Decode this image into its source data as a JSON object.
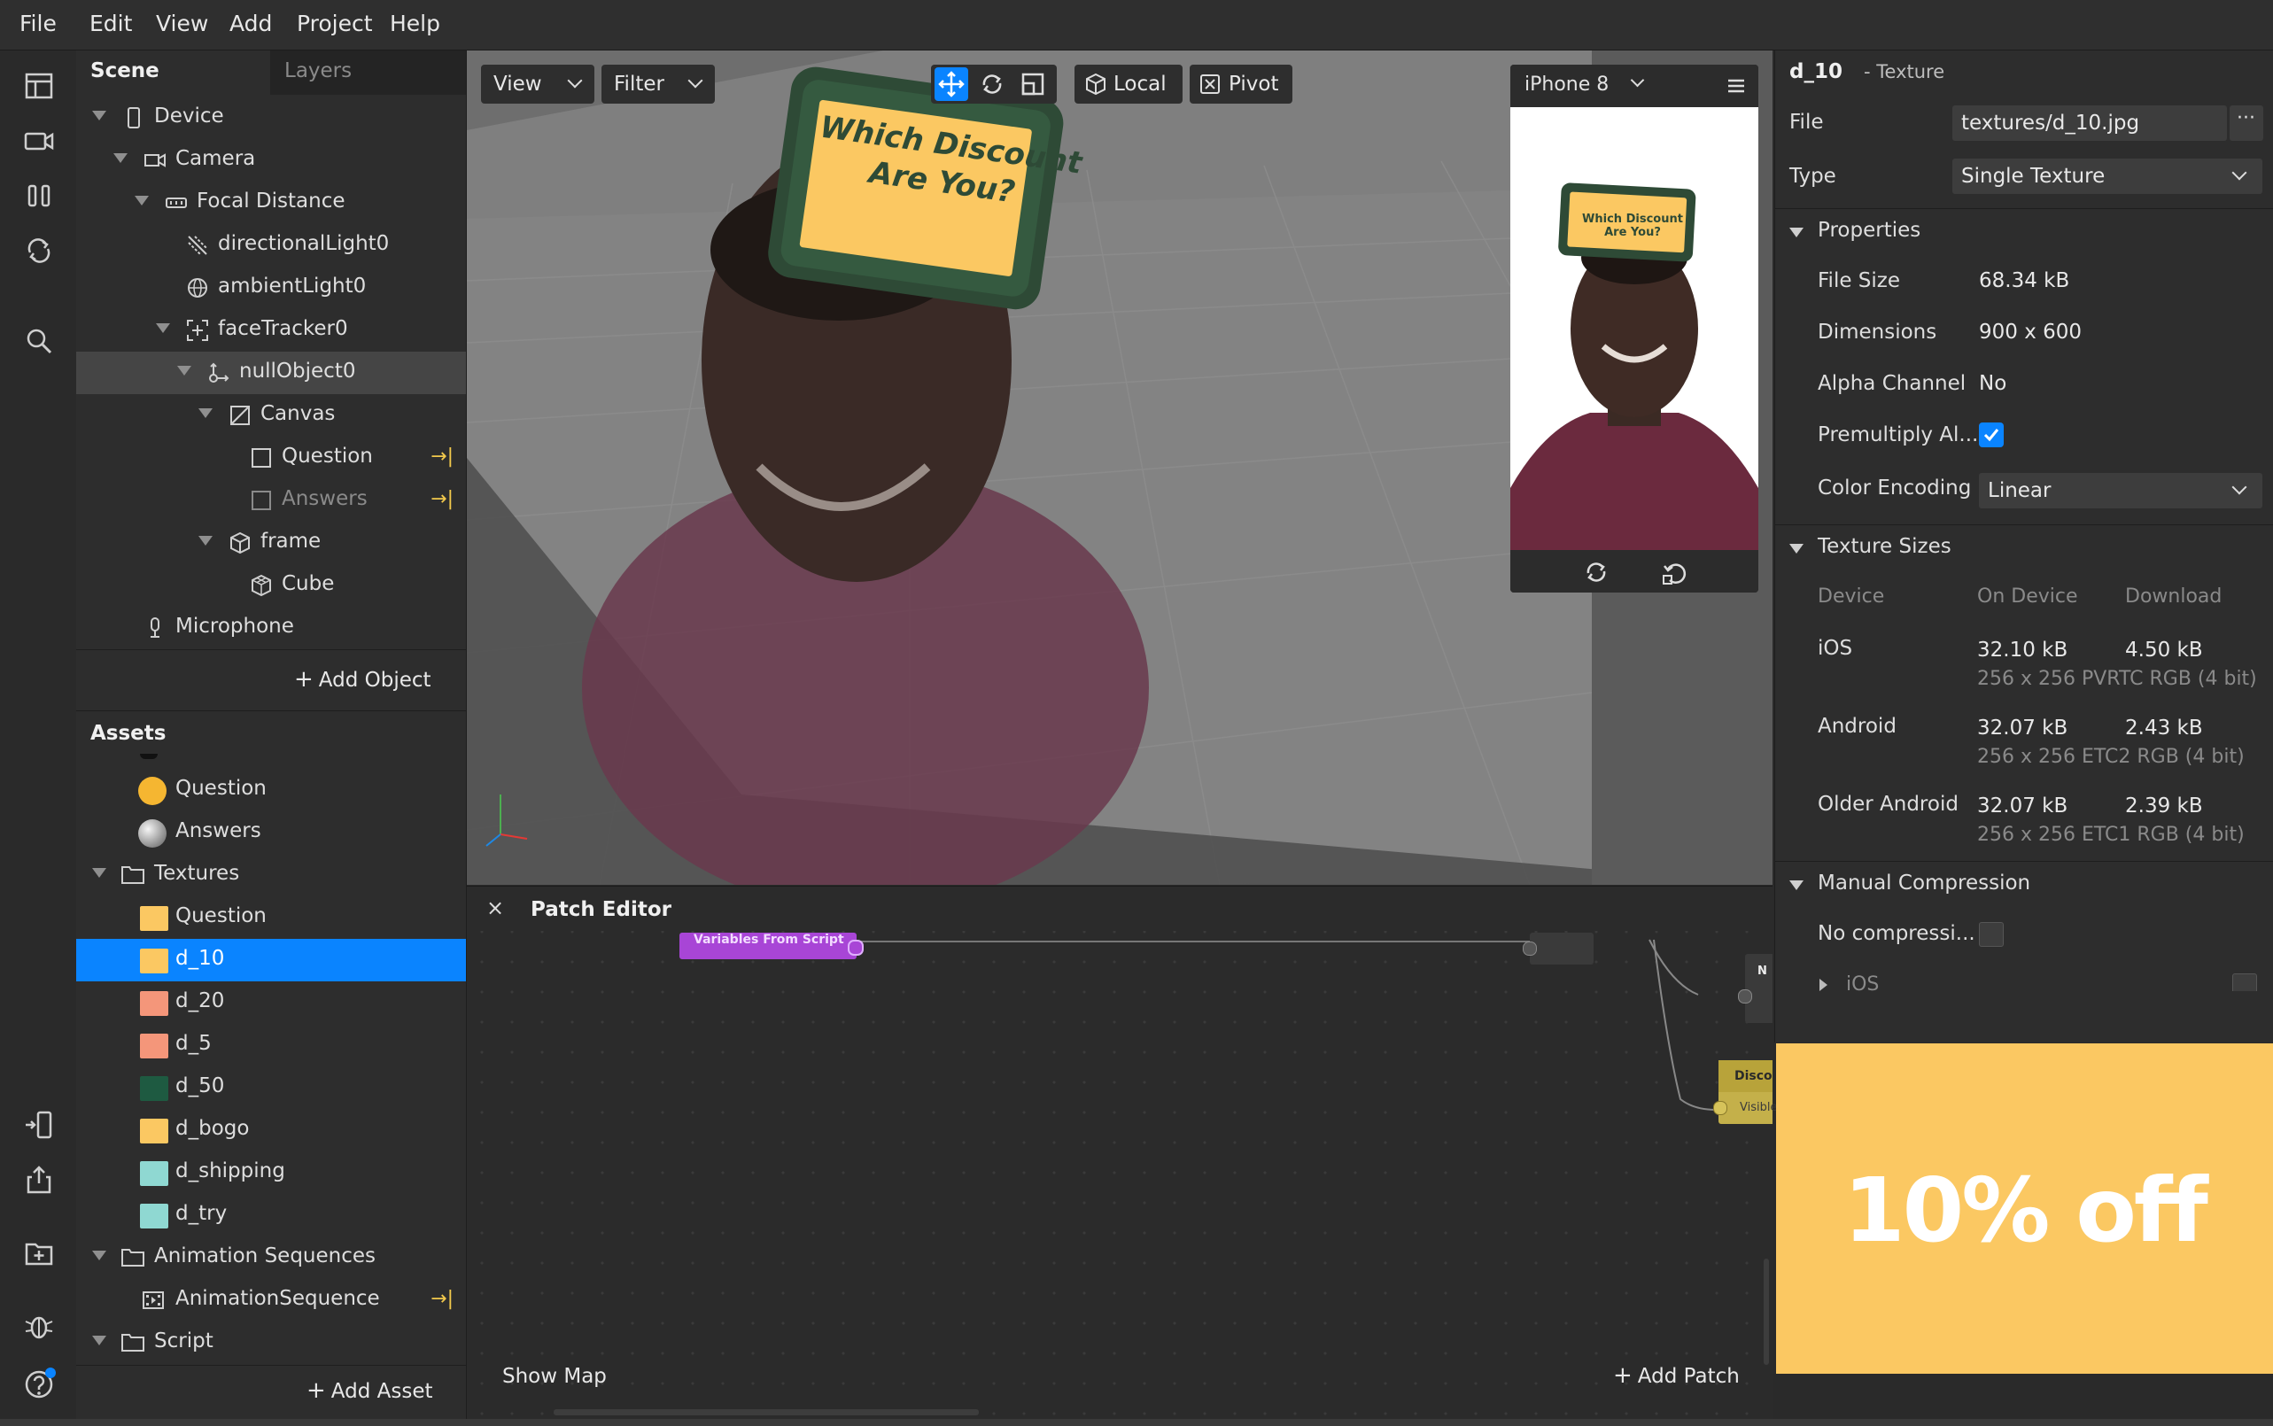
{
  "menu": [
    "File",
    "Edit",
    "View",
    "Add",
    "Project",
    "Help"
  ],
  "scene_panel": {
    "tabs": [
      "Scene",
      "Layers"
    ],
    "tree": [
      {
        "label": "Device",
        "icon": "phone-icon"
      },
      {
        "label": "Camera",
        "icon": "camera-icon"
      },
      {
        "label": "Focal Distance",
        "icon": "focal-distance-icon"
      },
      {
        "label": "directionalLight0",
        "icon": "directional-light-icon"
      },
      {
        "label": "ambientLight0",
        "icon": "ambient-light-icon"
      },
      {
        "label": "faceTracker0",
        "icon": "face-tracker-icon"
      },
      {
        "label": "nullObject0",
        "icon": "null-object-icon"
      },
      {
        "label": "Canvas",
        "icon": "canvas-icon"
      },
      {
        "label": "Question",
        "icon": "rectangle-icon"
      },
      {
        "label": "Answers",
        "icon": "rectangle-icon"
      },
      {
        "label": "frame",
        "icon": "3d-object-icon"
      },
      {
        "label": "Cube",
        "icon": "cube-icon"
      },
      {
        "label": "Microphone",
        "icon": "microphone-icon"
      }
    ],
    "add_object": "Add Object"
  },
  "assets_panel": {
    "title": "Assets",
    "items": [
      {
        "label": "Question",
        "color": "#f5b631"
      },
      {
        "label": "Answers",
        "color": "#bdbdbd"
      },
      {
        "label": "Textures",
        "color": ""
      },
      {
        "label": "Question",
        "color": "#fbc862"
      },
      {
        "label": "d_10",
        "color": "#fbc862"
      },
      {
        "label": "d_20",
        "color": "#f4967a"
      },
      {
        "label": "d_5",
        "color": "#f4967a"
      },
      {
        "label": "d_50",
        "color": "#1e5a41"
      },
      {
        "label": "d_bogo",
        "color": "#fbc862"
      },
      {
        "label": "d_shipping",
        "color": "#8fd8d2"
      },
      {
        "label": "d_try",
        "color": "#8fd8d2"
      },
      {
        "label": "Animation Sequences",
        "color": ""
      },
      {
        "label": "AnimationSequence",
        "color": ""
      },
      {
        "label": "Script",
        "color": ""
      }
    ],
    "add_asset": "Add Asset"
  },
  "viewport": {
    "view_btn": "View",
    "filter_btn": "Filter",
    "local_btn": "Local",
    "pivot_btn": "Pivot",
    "sign_text_1": "Which Discount",
    "sign_text_2": "Are You?"
  },
  "phone_preview": {
    "device": "iPhone 8",
    "sign_text_1": "Which Discount",
    "sign_text_2": "Are You?"
  },
  "patch_editor": {
    "title": "Patch Editor",
    "node_script": "Variables From Script",
    "node_right_1": "N",
    "node_right_2": "Discou",
    "node_right_2_port": "Visible",
    "show_map": "Show Map",
    "add_patch": "Add Patch"
  },
  "inspector": {
    "name": "d_10",
    "kind": "- Texture",
    "file_label": "File",
    "file_value": "textures/d_10.jpg",
    "type_label": "Type",
    "type_value": "Single Texture",
    "properties_title": "Properties",
    "file_size_label": "File Size",
    "file_size_value": "68.34 kB",
    "dimensions_label": "Dimensions",
    "dimensions_value": "900 x 600",
    "alpha_label": "Alpha Channel",
    "alpha_value": "No",
    "premultiply_label": "Premultiply Al...",
    "color_encoding_label": "Color Encoding",
    "color_encoding_value": "Linear",
    "texture_sizes_title": "Texture Sizes",
    "cols": [
      "Device",
      "On Device",
      "Download"
    ],
    "sizes": [
      {
        "device": "iOS",
        "on_device": "32.10 kB",
        "download": "4.50 kB",
        "format": "256 x 256 PVRTC RGB (4 bit)"
      },
      {
        "device": "Android",
        "on_device": "32.07 kB",
        "download": "2.43 kB",
        "format": "256 x 256 ETC2 RGB (4 bit)"
      },
      {
        "device": "Older Android",
        "on_device": "32.07 kB",
        "download": "2.39 kB",
        "format": "256 x 256 ETC1 RGB (4 bit)"
      }
    ],
    "manual_compression_title": "Manual Compression",
    "no_compression_label": "No compressi...",
    "ios_sub": "iOS"
  },
  "texture_preview": {
    "text": "10% off",
    "color": "#fbc862"
  }
}
